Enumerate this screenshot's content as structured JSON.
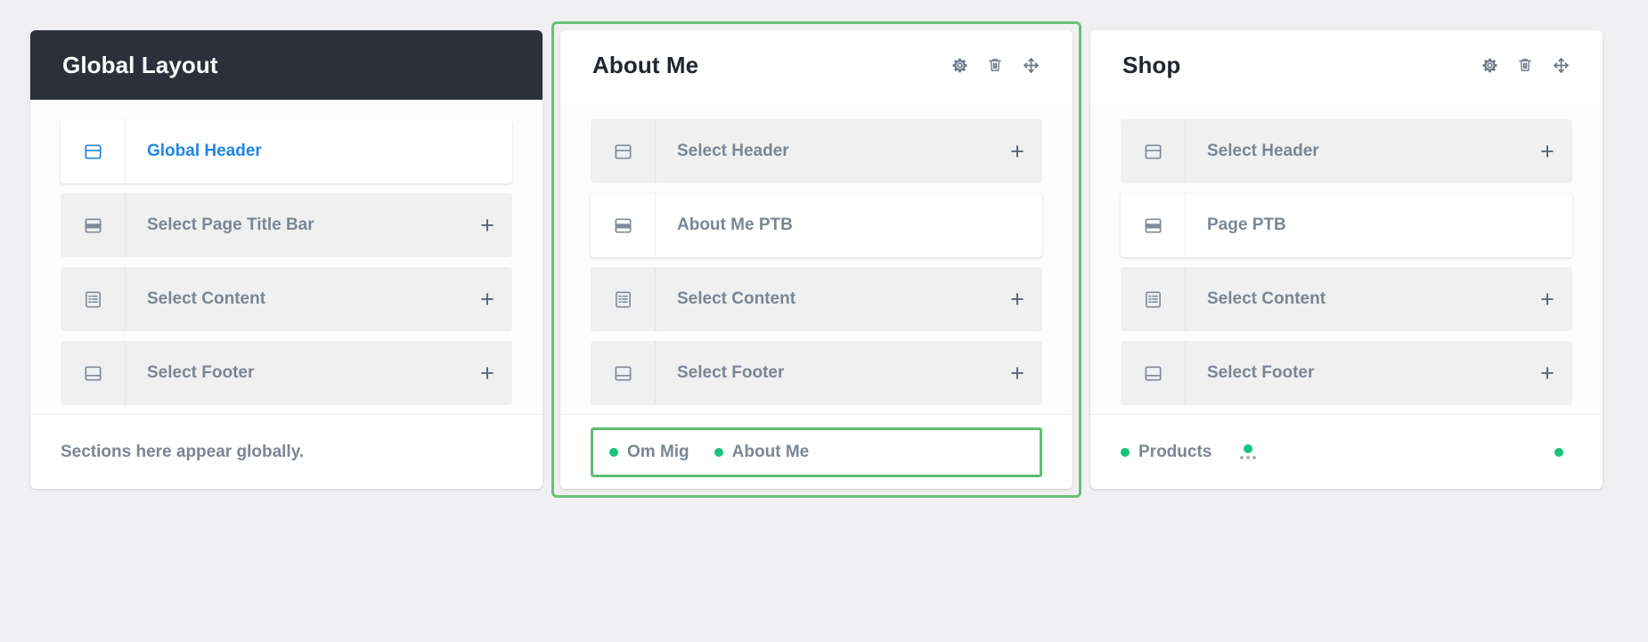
{
  "theme": {
    "page_bg": "#f0f0f2",
    "dark_header_bg": "#2b303a",
    "accent_blue": "#1e87e5",
    "selection_green": "#6ac077",
    "tag_green": "#19c37d",
    "muted_text": "#7b8694"
  },
  "cards": [
    {
      "title": "Global Layout",
      "header_style": "dark",
      "selected": false,
      "has_actions": false,
      "actions": [],
      "rows": [
        {
          "icon": "header-layout-icon",
          "label": "Global Header",
          "state": "filled",
          "accent": true,
          "plus": false
        },
        {
          "icon": "page-title-bar-icon",
          "label": "Select Page Title Bar",
          "state": "empty",
          "accent": false,
          "plus": true
        },
        {
          "icon": "content-layout-icon",
          "label": "Select Content",
          "state": "empty",
          "accent": false,
          "plus": true
        },
        {
          "icon": "footer-layout-icon",
          "label": "Select Footer",
          "state": "empty",
          "accent": false,
          "plus": true
        }
      ],
      "footer": {
        "type": "note",
        "note": "Sections here appear globally."
      }
    },
    {
      "title": "About Me",
      "header_style": "light",
      "selected": true,
      "has_actions": true,
      "actions": [
        {
          "name": "gear-icon",
          "label": "Settings"
        },
        {
          "name": "trash-icon",
          "label": "Delete"
        },
        {
          "name": "move-icon",
          "label": "Move"
        }
      ],
      "rows": [
        {
          "icon": "header-layout-icon",
          "label": "Select Header",
          "state": "empty",
          "accent": false,
          "plus": true
        },
        {
          "icon": "page-title-bar-icon",
          "label": "About Me PTB",
          "state": "filled",
          "accent": false,
          "plus": false
        },
        {
          "icon": "content-layout-icon",
          "label": "Select Content",
          "state": "empty",
          "accent": false,
          "plus": true
        },
        {
          "icon": "footer-layout-icon",
          "label": "Select Footer",
          "state": "empty",
          "accent": false,
          "plus": true
        }
      ],
      "footer": {
        "type": "tags",
        "outlined": true,
        "tags": [
          {
            "label": "Om Mig",
            "truncated": false
          },
          {
            "label": "About Me",
            "truncated": false
          }
        ],
        "trailing_dot": false
      }
    },
    {
      "title": "Shop",
      "header_style": "light",
      "selected": false,
      "has_actions": true,
      "actions": [
        {
          "name": "gear-icon",
          "label": "Settings"
        },
        {
          "name": "trash-icon",
          "label": "Delete"
        },
        {
          "name": "move-icon",
          "label": "Move"
        }
      ],
      "rows": [
        {
          "icon": "header-layout-icon",
          "label": "Select Header",
          "state": "empty",
          "accent": false,
          "plus": true
        },
        {
          "icon": "page-title-bar-icon",
          "label": "Page PTB",
          "state": "filled",
          "accent": false,
          "plus": false
        },
        {
          "icon": "content-layout-icon",
          "label": "Select Content",
          "state": "empty",
          "accent": false,
          "plus": true
        },
        {
          "icon": "footer-layout-icon",
          "label": "Select Footer",
          "state": "empty",
          "accent": false,
          "plus": true
        }
      ],
      "footer": {
        "type": "tags",
        "outlined": false,
        "tags": [
          {
            "label": "Products",
            "truncated": false
          },
          {
            "label": "",
            "truncated": true
          }
        ],
        "trailing_dot": true
      }
    }
  ],
  "glyphs": {
    "plus": "+"
  }
}
